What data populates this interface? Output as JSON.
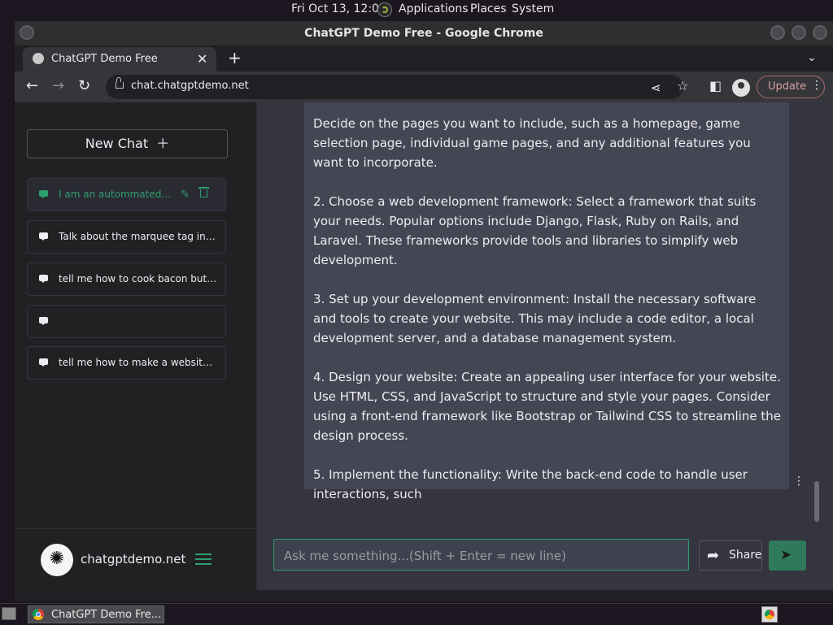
{
  "panel": {
    "clock": "Fri Oct 13, 12:07",
    "menus": [
      "Applications",
      "Places",
      "System"
    ]
  },
  "browser": {
    "window_title": "ChatGPT Demo Free - Google Chrome",
    "tab_title": "ChatGPT Demo Free",
    "url": "chat.chatgptdemo.net",
    "update_label": "Update"
  },
  "sidebar": {
    "new_chat_label": "New Chat",
    "chats": [
      {
        "title": "I am an autommated script"
      },
      {
        "title": "Talk about the marquee tag in great detail"
      },
      {
        "title": "tell me how to cook bacon but write it as a poem"
      },
      {
        "title": ""
      },
      {
        "title": "tell me how to make a website but in steps"
      }
    ],
    "brand": "chatgptdemo.net"
  },
  "conversation": {
    "message": "Decide on the pages you want to include, such as a homepage, game selection page, individual game pages, and any additional features you want to incorporate.\n\n2. Choose a web development framework: Select a framework that suits your needs. Popular options include Django, Flask, Ruby on Rails, and Laravel. These frameworks provide tools and libraries to simplify web development.\n\n3. Set up your development environment: Install the necessary software and tools to create your website. This may include a code editor, a local development server, and a database management system.\n\n4. Design your website: Create an appealing user interface for your website. Use HTML, CSS, and JavaScript to structure and style your pages. Consider using a front-end framework like Bootstrap or Tailwind CSS to streamline the design process.\n\n5. Implement the functionality: Write the back-end code to handle user interactions, such"
  },
  "composer": {
    "placeholder": "Ask me something...(Shift + Enter = new line)",
    "value": "",
    "share_label": "Share"
  },
  "taskbar": {
    "task_label": "ChatGPT Demo Fre..."
  },
  "colors": {
    "accent": "#2f9e6e",
    "sidebar_bg": "#202123",
    "main_bg": "#343541",
    "message_bg": "#444654"
  }
}
